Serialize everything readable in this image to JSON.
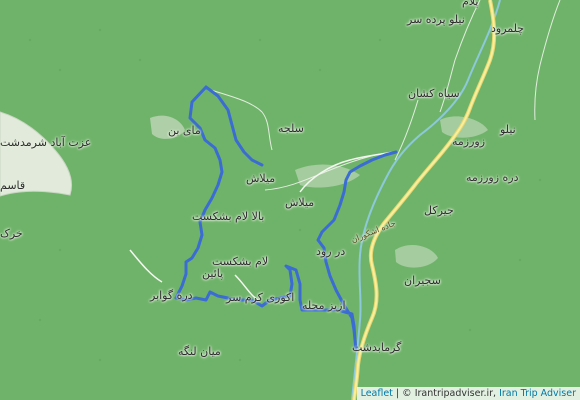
{
  "map": {
    "colors": {
      "forest": "#6fb36a",
      "clearing": "#dfe9d6",
      "track": "#3d6fd6",
      "road": "#f2e58a",
      "river": "#7cc4d8"
    },
    "labels": {
      "pelam": "پلام",
      "chalmrood": "چلمرود",
      "nilo_pardeh_sar": "نیلو پرده سر",
      "siah_kasan": "سیاه کشان",
      "nilo": "نیلو",
      "zoorzameh": "زورزمه",
      "dareh_zoorzameh": "دره زورزمه",
      "mey_bon": "مای بن",
      "salajeh": "سلجه",
      "ezzatabad": "عزت آباد شرمدشت",
      "ghasem": "قاسم",
      "kharak": "خرک",
      "meylash1": "میلاش",
      "meylash2": "میلاش",
      "bala_lam": "بالا لام بشکست",
      "jirkal": "جیرکل",
      "road_name": "جاده اشکوران",
      "darrood": "در رود",
      "lam_pain_1": "لام بشکست",
      "lam_pain_2": "پائین",
      "sejiran": "سجیران",
      "dareh_gavar": "دره گوابر",
      "akooraki": "اکوری کرم سر",
      "aziz_mahaleh": "ازیز محله",
      "garmabdasht": "گرمابدشت",
      "mian_langeh": "میان لنگه"
    }
  },
  "attribution": {
    "leaflet": "Leaflet",
    "sep": " | © ",
    "site": "Irantripadviser.ir",
    "comma": ", ",
    "brand": "Iran Trip Adviser"
  }
}
